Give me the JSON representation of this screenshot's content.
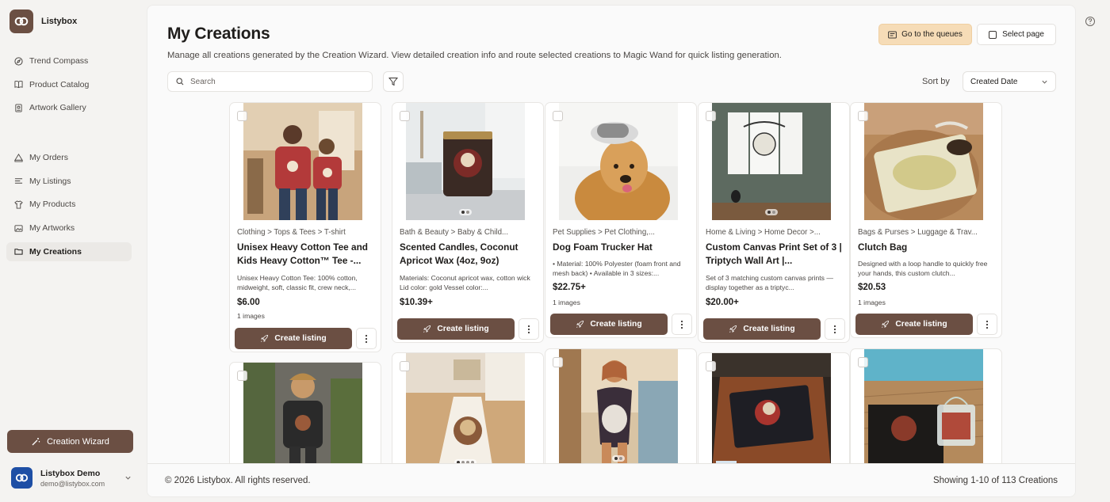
{
  "app": {
    "name": "Listybox"
  },
  "sidebar": {
    "group1": [
      {
        "label": "Trend Compass",
        "icon": "compass-icon"
      },
      {
        "label": "Product Catalog",
        "icon": "book-icon"
      },
      {
        "label": "Artwork Gallery",
        "icon": "gallery-icon"
      }
    ],
    "group2": [
      {
        "label": "My Orders",
        "icon": "orders-icon"
      },
      {
        "label": "My Listings",
        "icon": "list-icon"
      },
      {
        "label": "My Products",
        "icon": "shirt-icon"
      },
      {
        "label": "My Artworks",
        "icon": "artwork-icon"
      },
      {
        "label": "My Creations",
        "icon": "folder-icon",
        "active": true
      }
    ],
    "wizard_button": "Creation Wizard",
    "user": {
      "name": "Listybox Demo",
      "email": "demo@listybox.com"
    }
  },
  "header": {
    "title": "My Creations",
    "subtitle": "Manage all creations generated by the Creation Wizard. View detailed creation info and route selected creations to Magic Wand for quick listing generation.",
    "queues_button": "Go to the queues",
    "select_page_button": "Select page"
  },
  "toolbar": {
    "search_placeholder": "Search",
    "sort_label": "Sort by",
    "sort_value": "Created Date"
  },
  "create_label": "Create listing",
  "cards": [
    {
      "category": "Clothing > Tops & Tees > T-shirt",
      "title": "Unisex Heavy Cotton Tee and Kids Heavy Cotton™ Tee -...",
      "desc": "Unisex Heavy Cotton Tee: 100% cotton, midweight, soft, classic fit, crew neck,...",
      "price": "$6.00",
      "images": "1 images"
    },
    {
      "category": "Bath & Beauty > Baby & Child...",
      "title": "Scented Candles, Coconut Apricot Wax (4oz, 9oz)",
      "desc": "Materials: Coconut apricot wax, cotton wick Lid color: gold Vessel color:...",
      "price": "$10.39+",
      "images": ""
    },
    {
      "category": "Pet Supplies > Pet Clothing,...",
      "title": "Dog Foam Trucker Hat",
      "desc": "• Material: 100% Polyester (foam front and mesh back) • Available in 3 sizes:...",
      "price": "$22.75+",
      "images": "1 images"
    },
    {
      "category": "Home & Living > Home Decor >...",
      "title": "Custom Canvas Print Set of 3 | Triptych Wall Art |...",
      "desc": "Set of 3 matching custom canvas prints — display together as a triptyc...",
      "price": "$20.00+",
      "images": ""
    },
    {
      "category": "Bags & Purses > Luggage & Trav...",
      "title": "Clutch Bag",
      "desc": "Designed with a loop handle to quickly free your hands, this custom clutch...",
      "price": "$20.53",
      "images": "1 images"
    }
  ],
  "footer": {
    "copyright": "© 2026 Listybox.  All rights reserved.",
    "showing": "Showing 1-10 of 113 Creations"
  }
}
